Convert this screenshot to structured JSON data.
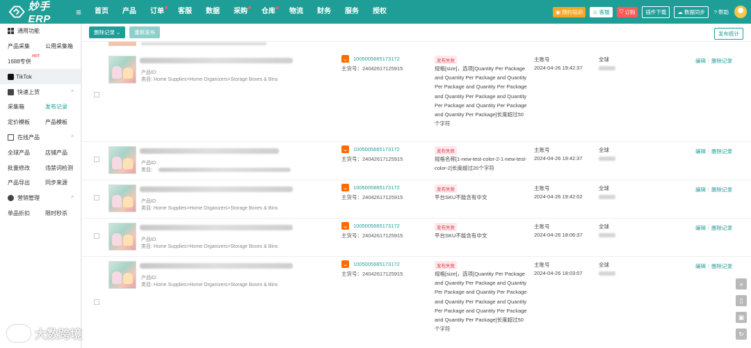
{
  "app": {
    "logo_text": "妙手ERP",
    "accent": "#1f9e97"
  },
  "nav": [
    {
      "label": "首页",
      "dot": false
    },
    {
      "label": "产品",
      "dot": false
    },
    {
      "label": "订单",
      "dot": true
    },
    {
      "label": "客服",
      "dot": false
    },
    {
      "label": "数据",
      "dot": false
    },
    {
      "label": "采购",
      "dot": true
    },
    {
      "label": "仓库",
      "dot": true
    },
    {
      "label": "物流",
      "dot": false
    },
    {
      "label": "财务",
      "dot": false
    },
    {
      "label": "服务",
      "dot": false
    },
    {
      "label": "授权",
      "dot": false
    }
  ],
  "top_right": {
    "training": "预约培训",
    "kefu": "客服",
    "order": "订购",
    "plugin": "插件下载",
    "sync": "数据同步",
    "help": "帮助"
  },
  "sidebar": {
    "common": "通用功能",
    "product_collect": "产品采集",
    "public_box": "公用采集箱",
    "t1688": "1688专供",
    "hot": "HOT",
    "tiktok": "TikTok",
    "quick_upload": "快速上货",
    "collect_box": "采集箱",
    "publish_record": "发布记录",
    "pricing_tpl": "定价模板",
    "product_tpl": "产品模板",
    "online_products": "在线产品",
    "global_products": "全球产品",
    "shop_products": "店铺产品",
    "batch_edit": "批量修改",
    "banned_words": "违禁词检测",
    "product_export": "产品导出",
    "sync_source": "同步来源",
    "marketing": "营销管理",
    "single_discount": "单品折扣",
    "flash_sale": "限时秒杀"
  },
  "toolbar": {
    "delete_record": "删除记录",
    "republish": "重新发布",
    "publish_stats": "发布统计"
  },
  "rows": [
    {
      "product_id_label": "产品ID:",
      "category": "类目: Home Supplies>Home Organizers>Storage Boxes & Bins",
      "sku_id": "1005005665173172",
      "main_no": "主货号：24042617125915",
      "status": "发布失败",
      "reason": "规格[size]，选项[Quantity Per Package and Quantity Per Package and Quantity Per Package and Quantity Per Package and Quantity Per Package and Quantity Per Package and Quantity Per Package and Quantity Per Package]长度超过50个字符",
      "account": "主账号",
      "time": "2024-04-26 19:42:37",
      "region": "全球",
      "edit": "编辑",
      "delete": "删除记录"
    },
    {
      "product_id_label": "产品ID:",
      "category": "类目:",
      "sku_id": "1005005665173172",
      "main_no": "主货号：24042617125915",
      "status": "发布失败",
      "reason": "规格名称[1-new-test-color-2-1-new-test-color-2]长度超过20个字符",
      "account": "主账号",
      "time": "2024-04-26 19:42:37",
      "region": "全球",
      "edit": "编辑",
      "delete": "删除记录"
    },
    {
      "product_id_label": "产品ID:",
      "category": "类目: Home Supplies>Home Organizers>Storage Boxes & Bins",
      "sku_id": "1005005665173172",
      "main_no": "主货号：24042617125915",
      "status": "发布失败",
      "reason": "平台SKU不能含有中文",
      "account": "主账号",
      "time": "2024-04-26 19:42:02",
      "region": "全球",
      "edit": "编辑",
      "delete": "删除记录"
    },
    {
      "product_id_label": "产品ID:",
      "category": "类目: Home Supplies>Home Organizers>Storage Boxes & Bins",
      "sku_id": "1005005665173172",
      "main_no": "主货号：24042617125915",
      "status": "发布失败",
      "reason": "平台SKU不能含有中文",
      "account": "主账号",
      "time": "2024-04-26 18:06:37",
      "region": "全球",
      "edit": "编辑",
      "delete": "删除记录"
    },
    {
      "product_id_label": "产品ID:",
      "category": "类目: Home Supplies>Home Organizers>Storage Boxes & Bins",
      "sku_id": "1005005665173172",
      "main_no": "主货号：24042617125915",
      "status": "发布失败",
      "reason": "规格[size]，选项[Quantity Per Package and Quantity Per Package and Quantity Per Package and Quantity Per Package and Quantity Per Package and Quantity Per Package and Quantity Per Package and Quantity Per Package]长度超过50个字符",
      "account": "主账号",
      "time": "2024-04-26 18:03:07",
      "region": "全球",
      "edit": "编辑",
      "delete": "删除记录"
    }
  ],
  "watermark": "大数跨境"
}
